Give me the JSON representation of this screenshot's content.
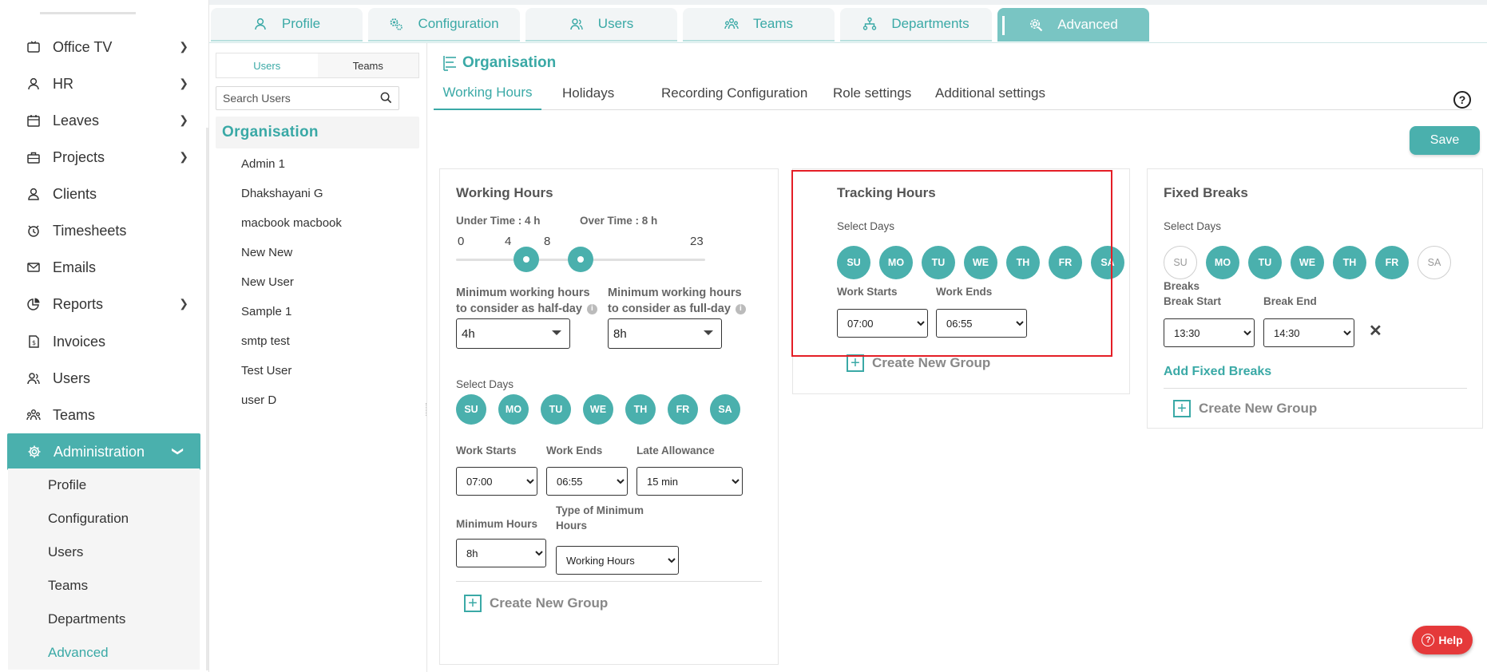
{
  "sidebar": {
    "items": [
      {
        "label": "Office TV",
        "icon": "tv-icon",
        "chevron": true
      },
      {
        "label": "HR",
        "icon": "person-icon",
        "chevron": true
      },
      {
        "label": "Leaves",
        "icon": "calendar-icon",
        "chevron": true
      },
      {
        "label": "Projects",
        "icon": "briefcase-icon",
        "chevron": true
      },
      {
        "label": "Clients",
        "icon": "client-icon",
        "chevron": false
      },
      {
        "label": "Timesheets",
        "icon": "clock-icon",
        "chevron": false
      },
      {
        "label": "Emails",
        "icon": "mail-icon",
        "chevron": false
      },
      {
        "label": "Reports",
        "icon": "pie-chart-icon",
        "chevron": true
      },
      {
        "label": "Invoices",
        "icon": "invoice-icon",
        "chevron": false
      },
      {
        "label": "Users",
        "icon": "users-icon",
        "chevron": false
      },
      {
        "label": "Teams",
        "icon": "teams-icon",
        "chevron": false
      },
      {
        "label": "Administration",
        "icon": "gear-icon",
        "chevron": true
      }
    ],
    "sub_items": [
      "Profile",
      "Configuration",
      "Users",
      "Teams",
      "Departments",
      "Advanced"
    ],
    "current_sub": "Advanced",
    "accent": "#4ab0ad"
  },
  "top_tabs": [
    {
      "label": "Profile",
      "icon": "person-icon"
    },
    {
      "label": "Configuration",
      "icon": "gears-icon"
    },
    {
      "label": "Users",
      "icon": "users-icon"
    },
    {
      "label": "Teams",
      "icon": "teams-icon"
    },
    {
      "label": "Departments",
      "icon": "sitemap-icon"
    },
    {
      "label": "Advanced",
      "icon": "gear-search-icon",
      "active": true
    }
  ],
  "users_panel": {
    "switch": {
      "users": "Users",
      "teams": "Teams"
    },
    "search_placeholder": "Search Users",
    "org_label": "Organisation",
    "users": [
      "Admin 1",
      "Dhakshayani G",
      "macbook macbook",
      "New New",
      "New User",
      "Sample 1",
      "smtp test",
      "Test User",
      "user D"
    ]
  },
  "main": {
    "title": "Organisation",
    "sub_tabs": [
      "Working Hours",
      "Holidays",
      "Recording Configuration",
      "Role settings",
      "Additional settings"
    ],
    "active_sub_tab": "Working Hours",
    "save_label": "Save",
    "help_q": "?",
    "help_button": "Help"
  },
  "working_hours": {
    "title": "Working Hours",
    "under_time": "Under Time : 4 h",
    "over_time": "Over Time : 8 h",
    "slider": {
      "min": 0,
      "max": 23,
      "low": 4,
      "high": 8,
      "ticks": [
        "0",
        "4",
        "8",
        "23"
      ]
    },
    "half_day_label": "Minimum working hours to consider as half-day",
    "half_day_value": "4h",
    "full_day_label": "Minimum working hours to consider as full-day",
    "full_day_value": "8h",
    "select_days_label": "Select Days",
    "days": [
      {
        "code": "SU",
        "on": true
      },
      {
        "code": "MO",
        "on": true
      },
      {
        "code": "TU",
        "on": true
      },
      {
        "code": "WE",
        "on": true
      },
      {
        "code": "TH",
        "on": true
      },
      {
        "code": "FR",
        "on": true
      },
      {
        "code": "SA",
        "on": true
      }
    ],
    "work_starts_label": "Work Starts",
    "work_starts": "07:00",
    "work_ends_label": "Work Ends",
    "work_ends": "06:55",
    "late_allowance_label": "Late Allowance",
    "late_allowance": "15 min",
    "min_hours_label": "Minimum Hours",
    "min_hours": "8h",
    "type_min_hours_label": "Type of Minimum Hours",
    "type_min_hours": "Working Hours",
    "create_group": "Create New Group"
  },
  "tracking_hours": {
    "title": "Tracking Hours",
    "select_days_label": "Select Days",
    "days": [
      {
        "code": "SU",
        "on": true
      },
      {
        "code": "MO",
        "on": true
      },
      {
        "code": "TU",
        "on": true
      },
      {
        "code": "WE",
        "on": true
      },
      {
        "code": "TH",
        "on": true
      },
      {
        "code": "FR",
        "on": true
      },
      {
        "code": "SA",
        "on": true
      }
    ],
    "work_starts_label": "Work Starts",
    "work_starts": "07:00",
    "work_ends_label": "Work Ends",
    "work_ends": "06:55",
    "create_group": "Create New Group"
  },
  "fixed_breaks": {
    "title": "Fixed Breaks",
    "select_days_label": "Select Days",
    "days": [
      {
        "code": "SU",
        "on": false
      },
      {
        "code": "MO",
        "on": true
      },
      {
        "code": "TU",
        "on": true
      },
      {
        "code": "WE",
        "on": true
      },
      {
        "code": "TH",
        "on": true
      },
      {
        "code": "FR",
        "on": true
      },
      {
        "code": "SA",
        "on": false
      }
    ],
    "breaks_label": "Breaks",
    "break_start_label": "Break Start",
    "break_start": "13:30",
    "break_end_label": "Break End",
    "break_end": "14:30",
    "remove_icon": "close-icon",
    "add_fixed_breaks": "Add Fixed Breaks",
    "create_group": "Create New Group"
  }
}
